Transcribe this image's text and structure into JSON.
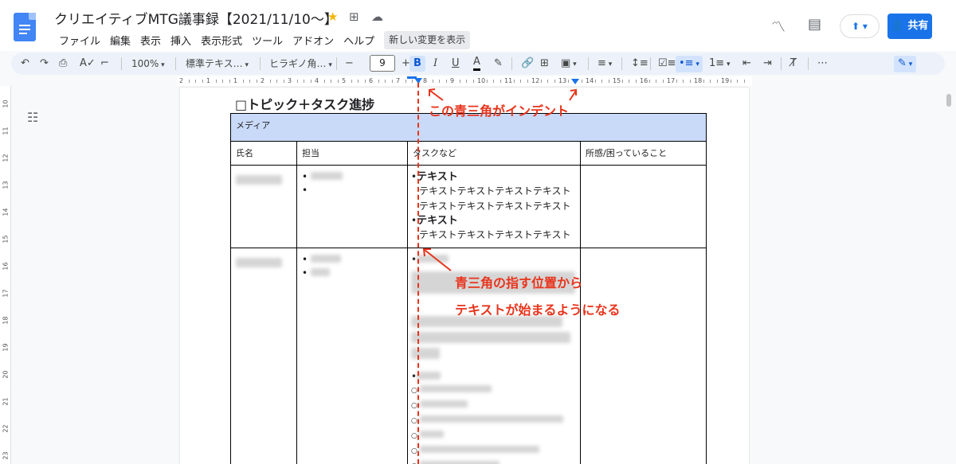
{
  "header": {
    "title": "クリエイティブMTG議事録【2021/11/10〜】",
    "menu": [
      "ファイル",
      "編集",
      "表示",
      "挿入",
      "表示形式",
      "ツール",
      "アドオン",
      "ヘルプ"
    ],
    "new_changes": "新しい変更を表示",
    "share_label": "共有"
  },
  "toolbar": {
    "zoom": "100%",
    "style": "標準テキス…",
    "font": "ヒラギノ角…",
    "font_size": "9",
    "minus": "−",
    "plus": "+",
    "bold": "B",
    "italic": "I",
    "underline": "U",
    "text_color": "A",
    "more": "⋯"
  },
  "ruler": {
    "numbers": [
      "2",
      "1",
      "1",
      "2",
      "3",
      "4",
      "5",
      "6",
      "7",
      "8",
      "9",
      "10",
      "11",
      "12",
      "13",
      "14",
      "15",
      "16",
      "17",
      "18",
      "19"
    ],
    "vertical_numbers": [
      "10",
      "11",
      "12",
      "13",
      "14",
      "15",
      "16",
      "17",
      "18",
      "19",
      "20",
      "21",
      "22",
      "23"
    ]
  },
  "document": {
    "heading": "□トピック＋タスク進捗",
    "table": {
      "section": "メディア",
      "columns": [
        "氏名",
        "担当",
        "タスクなど",
        "所感/困っていること"
      ],
      "row1_tasks": [
        {
          "title": "テキスト",
          "lines": [
            "テキストテキストテキストテキスト",
            "テキストテキストテキストテキスト"
          ]
        },
        {
          "title": "テキスト",
          "lines": [
            "テキストテキストテキストテキスト"
          ]
        }
      ]
    }
  },
  "annotations": {
    "indent_note": "この青三角がインデント",
    "explain_line1": "青三角の指す位置から",
    "explain_line2": "テキストが始まるようになる",
    "color": "#e8341c"
  }
}
